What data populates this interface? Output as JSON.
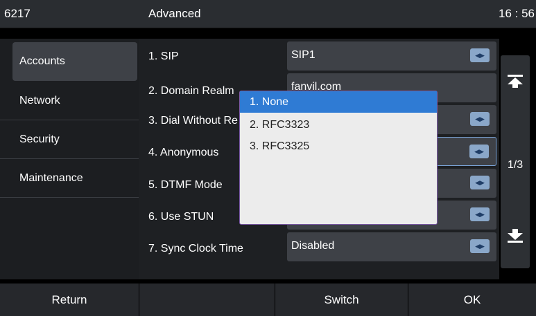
{
  "topbar": {
    "extension": "6217",
    "title": "Advanced",
    "time": "16 : 56"
  },
  "sidebar": {
    "items": [
      {
        "label": "Accounts"
      },
      {
        "label": "Network"
      },
      {
        "label": "Security"
      },
      {
        "label": "Maintenance"
      }
    ]
  },
  "settings": {
    "rows": [
      {
        "label": "1. SIP",
        "value": "SIP1"
      },
      {
        "label": "2. Domain Realm",
        "value": "fanvil.com"
      },
      {
        "label": "3. Dial Without Re",
        "value": ""
      },
      {
        "label": "4. Anonymous",
        "value": ""
      },
      {
        "label": "5. DTMF Mode",
        "value": ""
      },
      {
        "label": "6. Use STUN",
        "value": ""
      },
      {
        "label": "7. Sync Clock Time",
        "value": "Disabled"
      }
    ]
  },
  "pager": {
    "page": "1/3"
  },
  "popup": {
    "options": [
      {
        "index": "1.",
        "label": "None"
      },
      {
        "index": "2.",
        "label": "RFC3323"
      },
      {
        "index": "3.",
        "label": "RFC3325"
      }
    ]
  },
  "bottom": {
    "return_label": "Return",
    "switch_label": "Switch",
    "ok_label": "OK"
  },
  "colors": {
    "highlight": "#2f7bd4",
    "arrow_button": "#8aa7c9",
    "popup_border": "#7b5aa6"
  },
  "icons": {
    "page_up": "arrow-to-top-icon",
    "page_down": "arrow-to-bottom-icon",
    "switch": "left-right-arrows-icon"
  }
}
